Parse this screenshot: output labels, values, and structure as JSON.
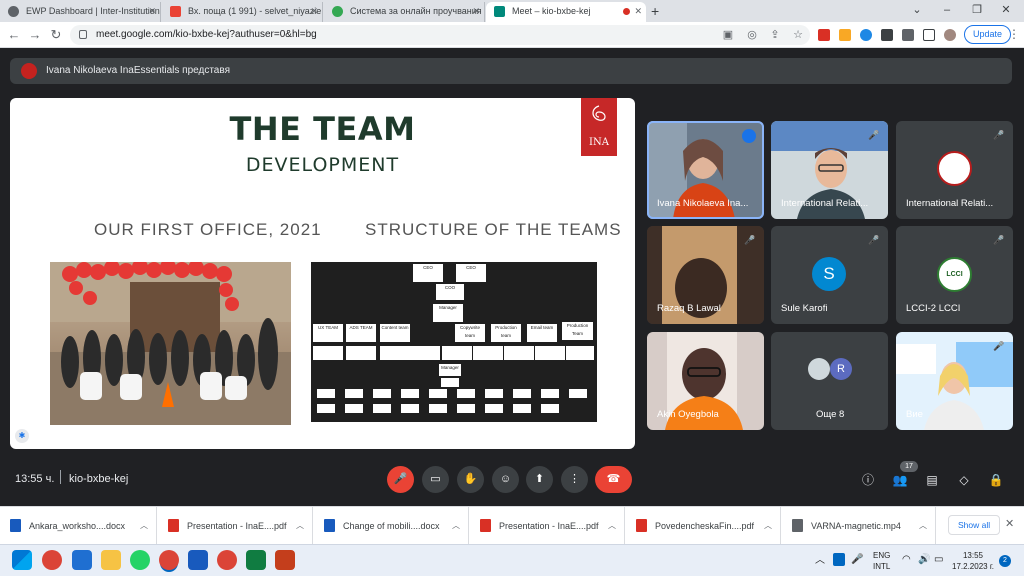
{
  "tabs": [
    {
      "title": "EWP Dashboard | Inter-Institution",
      "color": "#5f6368",
      "active": false
    },
    {
      "title": "Вх. поща (1 991) - selvet_niyazie",
      "color": "#ea4335",
      "active": false
    },
    {
      "title": "Система за онлайн проучвания",
      "color": "#34a853",
      "active": false
    },
    {
      "title": "Meet – kio-bxbe-kej",
      "color": "#00897b",
      "active": true
    }
  ],
  "address_bar": {
    "url": "meet.google.com/kio-bxbe-kej?authuser=0&hl=bg"
  },
  "toolbar": {
    "update_label": "Update"
  },
  "meet": {
    "presenter_label": "Ivana Nikolaeva InaEssentials представя",
    "slide": {
      "title": "THE TEAM",
      "subtitle": "DEVELOPMENT",
      "left_heading": "OUR FIRST OFFICE, 2021",
      "right_heading": "STRUCTURE OF THE TEAMS",
      "logo_text": "INA",
      "org_boxes": [
        "CEO",
        "CEO",
        "COO",
        "Manager",
        "UX TEAM",
        "ADS TEAM",
        "Content team",
        "Copywrite team",
        "Production team",
        "Email team",
        "Production Team",
        "Manager"
      ]
    },
    "participants": [
      {
        "name": "Ivana Nikolaeva Ina...",
        "type": "video",
        "speaking": true
      },
      {
        "name": "International Relati...",
        "type": "video",
        "muted": true
      },
      {
        "name": "International Relati...",
        "type": "logo",
        "muted": true
      },
      {
        "name": "Razaq B Lawal",
        "type": "video",
        "muted": true
      },
      {
        "name": "Sule Karofi",
        "type": "avatar",
        "initial": "S",
        "color": "#0288d1",
        "muted": true
      },
      {
        "name": "LCCI-2 LCCI",
        "type": "logo",
        "logo_text": "LCCI",
        "muted": true
      },
      {
        "name": "Akin Oyegbola",
        "type": "video"
      },
      {
        "name": "Още 8",
        "type": "group",
        "initial": "R"
      },
      {
        "name": "Вие",
        "type": "video",
        "muted": true
      }
    ],
    "controls": {
      "time": "13:55 ч.",
      "meeting_code": "kio-bxbe-kej",
      "participant_count": "17"
    }
  },
  "downloads": {
    "items": [
      {
        "name": "Ankara_worksho....docx",
        "color": "#185abd"
      },
      {
        "name": "Presentation - InaE....pdf",
        "color": "#d93025"
      },
      {
        "name": "Change of mobili....docx",
        "color": "#185abd"
      },
      {
        "name": "Presentation - InaE....pdf",
        "color": "#d93025"
      },
      {
        "name": "PovedencheskaFin....pdf",
        "color": "#d93025"
      },
      {
        "name": "VARNA-magnetic.mp4",
        "color": "#5f6368"
      }
    ],
    "show_all_label": "Show all"
  },
  "taskbar": {
    "lang_top": "ENG",
    "lang_bottom": "INTL",
    "time": "13:55",
    "date": "17.2.2023 г.",
    "notifications": "2"
  }
}
